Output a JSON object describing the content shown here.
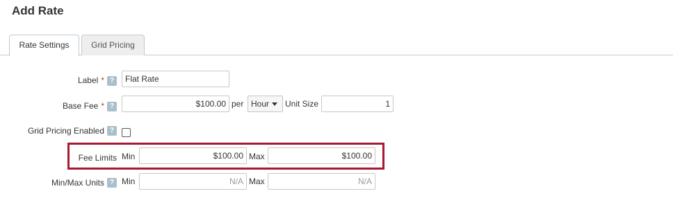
{
  "page": {
    "title": "Add Rate"
  },
  "tabs": [
    {
      "label": "Rate Settings",
      "active": true
    },
    {
      "label": "Grid Pricing",
      "active": false
    }
  ],
  "form": {
    "required_marker": "*",
    "help_glyph": "?",
    "label_row": {
      "label": "Label",
      "value": "Flat Rate"
    },
    "base_fee_row": {
      "label": "Base Fee",
      "value": "$100.00",
      "per_text": "per",
      "unit_selected": "Hour",
      "unit_size_label": "Unit Size",
      "unit_size_value": "1"
    },
    "grid_pricing_row": {
      "label": "Grid Pricing Enabled",
      "checked": false
    },
    "fee_limits_row": {
      "label": "Fee Limits",
      "min_label": "Min",
      "min_value": "$100.00",
      "max_label": "Max",
      "max_value": "$100.00",
      "highlight_color": "#a6192e"
    },
    "minmax_units_row": {
      "label": "Min/Max Units",
      "min_label": "Min",
      "min_placeholder": "N/A",
      "max_label": "Max",
      "max_placeholder": "N/A"
    }
  }
}
